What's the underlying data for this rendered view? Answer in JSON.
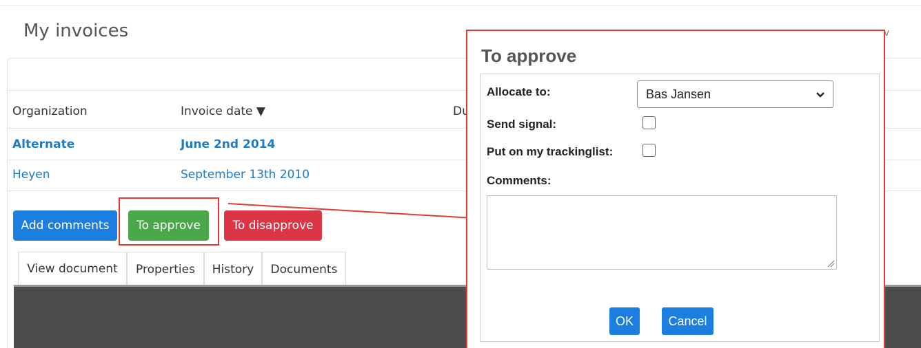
{
  "page": {
    "title": "My invoices"
  },
  "table": {
    "headers": {
      "organization": "Organization",
      "invoice_date": "Invoice date ▼",
      "partial_col": "Du"
    },
    "rows": [
      {
        "organization": "Alternate",
        "invoice_date": "June 2nd 2014"
      },
      {
        "organization": "Heyen",
        "invoice_date": "September 13th 2010"
      }
    ]
  },
  "actions": {
    "add_comments": "Add comments",
    "to_approve": "To approve",
    "to_disapprove": "To disapprove"
  },
  "tabs": [
    "View document",
    "Properties",
    "History",
    "Documents"
  ],
  "dialog": {
    "title": "To approve",
    "allocate_label": "Allocate to:",
    "allocate_value": "Bas Jansen",
    "send_signal_label": "Send signal:",
    "tracking_label": "Put on my trackinglist:",
    "comments_label": "Comments:",
    "ok_label": "OK",
    "cancel_label": "Cancel"
  },
  "colors": {
    "primary": "#1b7ee0",
    "success": "#4aa84a",
    "danger": "#dc3545",
    "highlight": "#e53935"
  },
  "icons": {
    "select_caret": "chevron-down-icon",
    "sort": "sort-desc-icon",
    "resize": "resize-grip-icon",
    "callout_arrow": "arrow-right-icon"
  }
}
